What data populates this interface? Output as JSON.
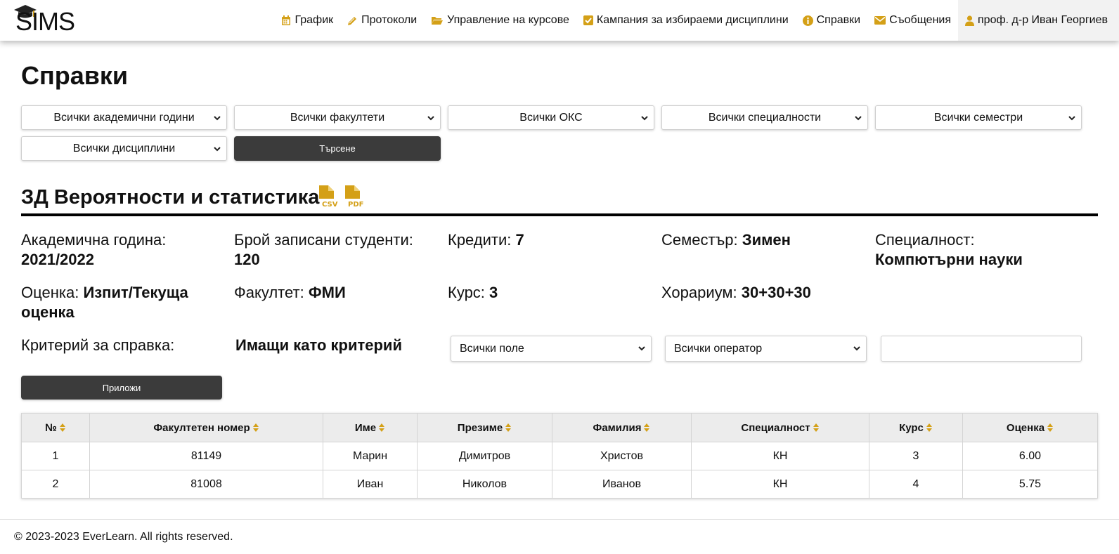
{
  "app": {
    "logo_text": "SIMS"
  },
  "nav": {
    "items": [
      {
        "label": "График",
        "icon": "calendar-icon"
      },
      {
        "label": "Протоколи",
        "icon": "pencil-icon"
      },
      {
        "label": "Управление на курсове",
        "icon": "folder-open-icon"
      },
      {
        "label": "Кампания за избираеми дисциплини",
        "icon": "check-square-icon"
      },
      {
        "label": "Справки",
        "icon": "info-circle-icon"
      },
      {
        "label": "Съобщения",
        "icon": "envelope-icon"
      }
    ],
    "user": {
      "label": "проф. д-р Иван Георгиев",
      "icon": "user-icon"
    }
  },
  "page": {
    "title": "Справки"
  },
  "filters": {
    "academic_year": "Всички академични години",
    "faculty": "Всички факултети",
    "degree": "Всички ОКС",
    "specialty": "Всички специалности",
    "semester": "Всички семестри",
    "discipline": "Всички дисциплини",
    "search_label": "Търсене"
  },
  "course": {
    "title": "ЗД Вероятности и статистика",
    "csv_icon": "csv-file-icon",
    "pdf_icon": "pdf-file-icon",
    "academic_year_label": "Академична година:",
    "academic_year_value": "2021/2022",
    "students_label": "Брой записани студенти:",
    "students_value": "120",
    "credits_label": "Кредити:",
    "credits_value": "7",
    "semester_label": "Семестър:",
    "semester_value": "Зимен",
    "specialty_label": "Специалност:",
    "specialty_value": "Компютърни науки",
    "grade_label": "Оценка:",
    "grade_value": "Изпит/Текуща оценка",
    "faculty_label": "Факултет:",
    "faculty_value": "ФМИ",
    "course_label": "Курс:",
    "course_value": "3",
    "hours_label": "Хорариум:",
    "hours_value": "30+30+30"
  },
  "criteria": {
    "label": "Критерий за справка:",
    "mode": "Имащи като критерий",
    "field": "Всички поле",
    "operator": "Всички оператор",
    "value": "",
    "apply_label": "Приложи"
  },
  "table": {
    "columns": [
      "№",
      "Факултетен номер",
      "Име",
      "Презиме",
      "Фамилия",
      "Специалност",
      "Курс",
      "Оценка"
    ],
    "rows": [
      [
        "1",
        "81149",
        "Марин",
        "Димитров",
        "Христов",
        "КН",
        "3",
        "6.00"
      ],
      [
        "2",
        "81008",
        "Иван",
        "Николов",
        "Иванов",
        "КН",
        "4",
        "5.75"
      ]
    ]
  },
  "colors": {
    "accent": "#d4a017",
    "dark_button": "#3b3b3b"
  },
  "footer": {
    "text": "© 2023-2023 EverLearn. All rights reserved."
  }
}
